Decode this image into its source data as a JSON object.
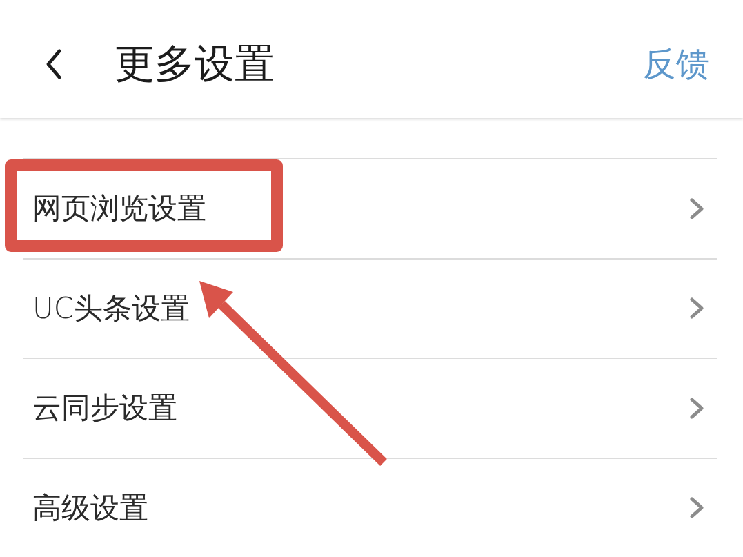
{
  "header": {
    "title": "更多设置",
    "action": "反馈"
  },
  "rows": [
    {
      "label": "网页浏览设置",
      "highlighted": true
    },
    {
      "label": "UC头条设置",
      "highlighted": false
    },
    {
      "label": "云同步设置",
      "highlighted": false
    },
    {
      "label": "高级设置",
      "highlighted": false
    }
  ]
}
